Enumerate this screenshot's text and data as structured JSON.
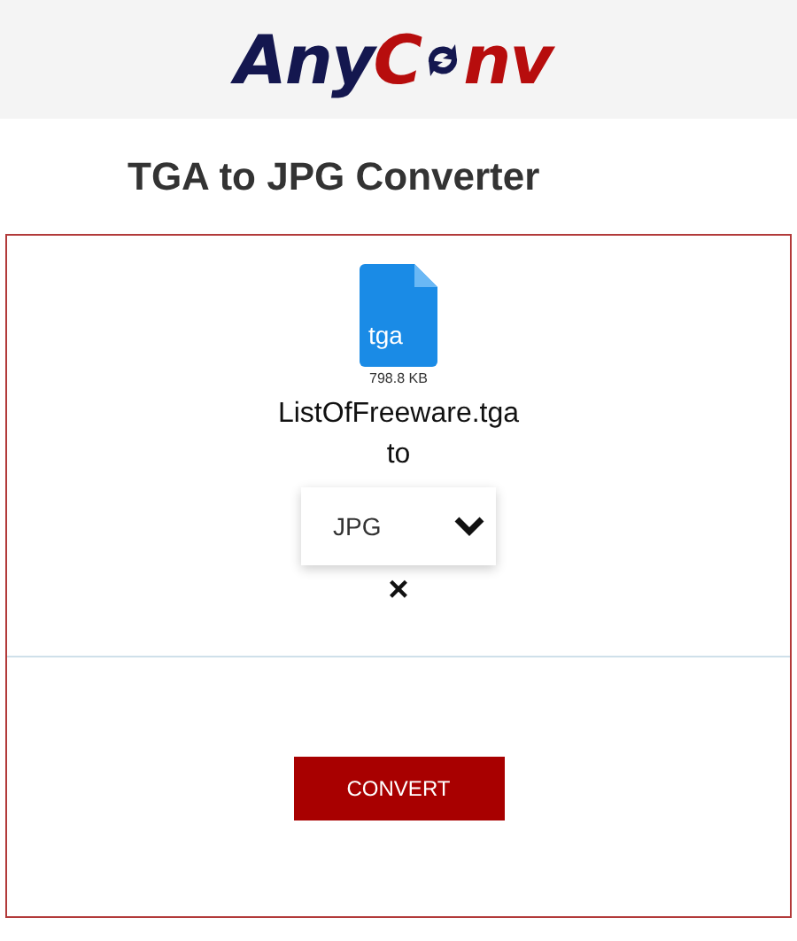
{
  "logo": {
    "first": "Any",
    "second": "C",
    "third": "nv"
  },
  "title": "TGA to JPG Converter",
  "file": {
    "extension": "tga",
    "size": "798.8 KB",
    "name": "ListOfFreeware.tga"
  },
  "to_label": "to",
  "format_select": {
    "value": "JPG"
  },
  "remove_icon": "×",
  "convert_button": "CONVERT"
}
